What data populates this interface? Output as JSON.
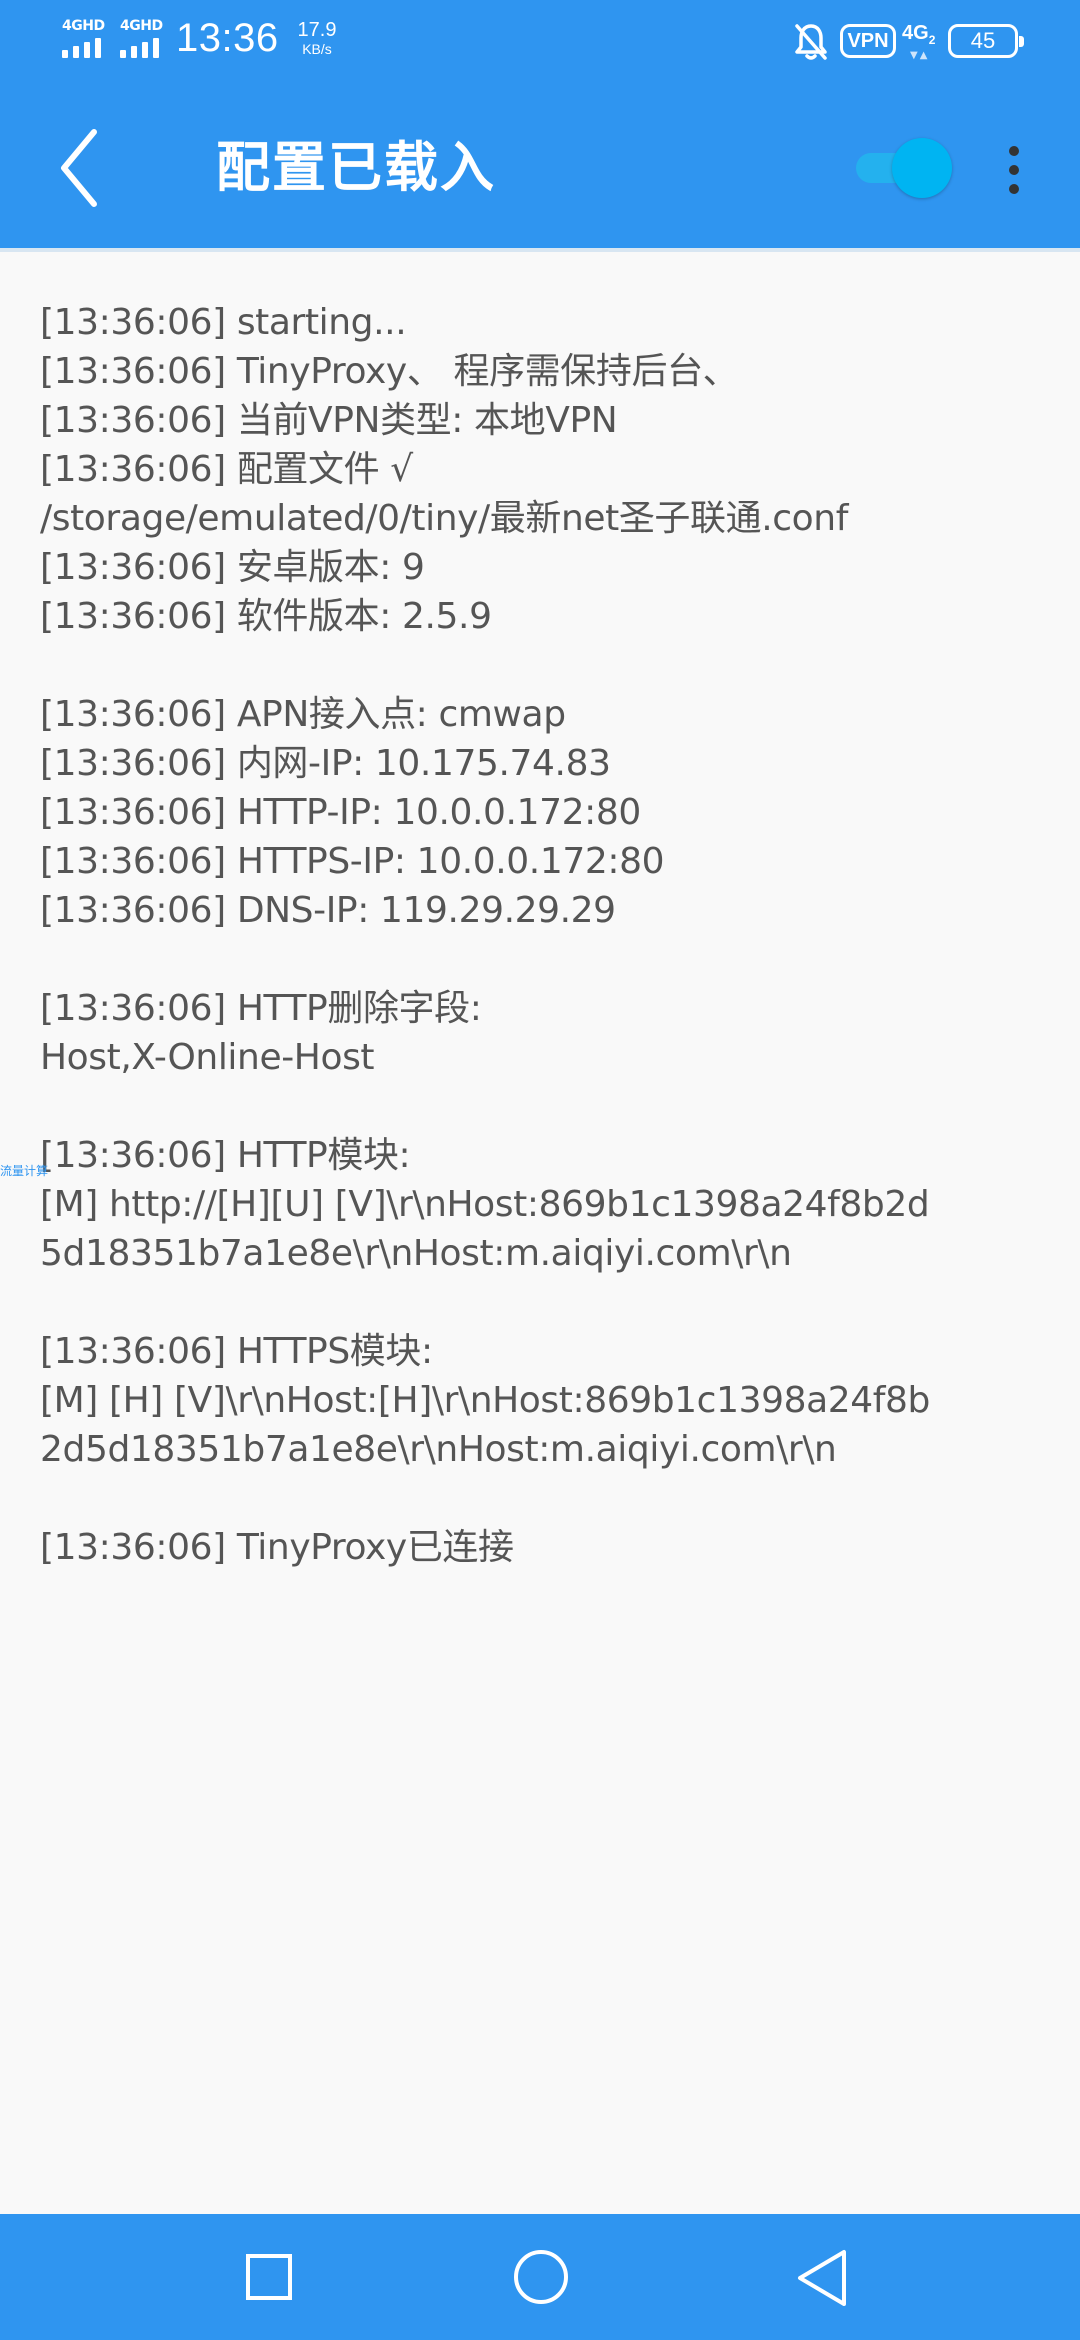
{
  "status_bar": {
    "network_label_1": "4GHD",
    "network_label_2": "4GHD",
    "time": "13:36",
    "speed_value": "17.9",
    "speed_unit": "KB/s",
    "vpn_badge": "VPN",
    "network_type": "4G",
    "network_sub": "2",
    "battery": "45"
  },
  "app_bar": {
    "title": "配置已载入",
    "toggle_on": true,
    "accent_color": "#2f95f0",
    "toggle_color": "#00b4f2"
  },
  "log": {
    "lines": [
      "[13:36:06] starting...",
      "[13:36:06] TinyProxy、 程序需保持后台、",
      "[13:36:06] 当前VPN类型: 本地VPN",
      "[13:36:06] 配置文件 √",
      "/storage/emulated/0/tiny/最新net圣子联通.conf",
      "[13:36:06] 安卓版本: 9",
      "[13:36:06] 软件版本: 2.5.9",
      "",
      "[13:36:06] APN接入点: cmwap",
      "[13:36:06] 内网-IP: 10.175.74.83",
      "[13:36:06] HTTP-IP: 10.0.0.172:80",
      "[13:36:06] HTTPS-IP: 10.0.0.172:80",
      "[13:36:06] DNS-IP: 119.29.29.29",
      "",
      "[13:36:06] HTTP删除字段:",
      "Host,X-Online-Host",
      "",
      "[13:36:06] HTTP模块:",
      "[M] http://[H][U] [V]\\r\\nHost:869b1c1398a24f8b2d",
      "5d18351b7a1e8e\\r\\nHost:m.aiqiyi.com\\r\\n",
      "",
      "[13:36:06] HTTPS模块:",
      "[M] [H] [V]\\r\\nHost:[H]\\r\\nHost:869b1c1398a24f8b",
      "2d5d18351b7a1e8e\\r\\nHost:m.aiqiyi.com\\r\\n",
      "",
      "[13:36:06] TinyProxy已连接"
    ]
  },
  "side_tag": "流量计算",
  "icons": {
    "back": "chevron-left-icon",
    "more": "more-vertical-icon",
    "mute": "bell-off-icon",
    "nav_recents": "square-icon",
    "nav_home": "circle-icon",
    "nav_back": "triangle-back-icon"
  }
}
